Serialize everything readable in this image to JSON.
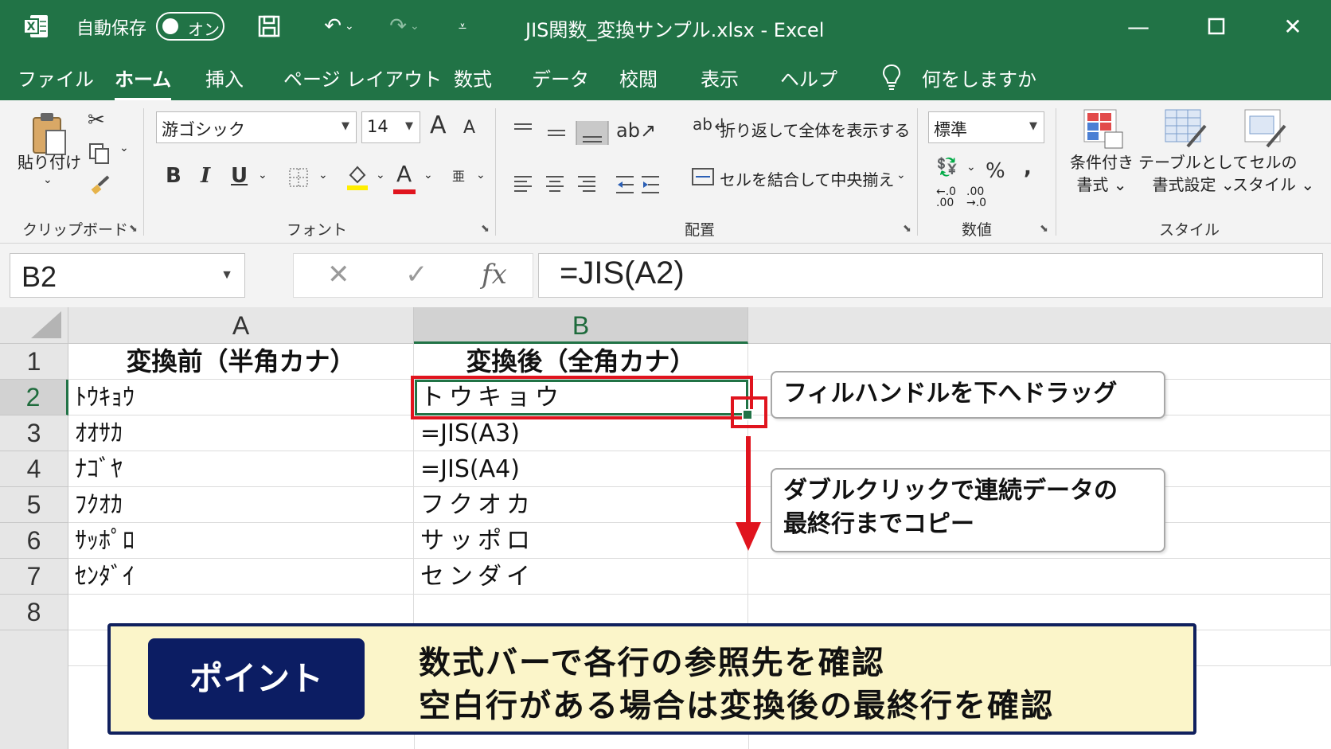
{
  "titlebar": {
    "autosave_label": "自動保存",
    "autosave_state": "オン",
    "doc_title": "JIS関数_変換サンプル.xlsx  -  Excel",
    "icons": [
      "excel-logo-icon",
      "save-icon",
      "undo-icon",
      "redo-icon",
      "customize-qat-icon",
      "minimize-icon",
      "maximize-icon",
      "close-icon"
    ]
  },
  "tabs": [
    "ファイル",
    "ホーム",
    "挿入",
    "ページ レイアウト",
    "数式",
    "データ",
    "校閲",
    "表示",
    "ヘルプ"
  ],
  "active_tab": "ホーム",
  "tell_me": "何をしますか",
  "ribbon": {
    "clipboard": {
      "paste": "貼り付け",
      "label": "クリップボード"
    },
    "font": {
      "name": "游ゴシック",
      "size": "14",
      "label": "フォント",
      "bold": "B",
      "italic": "I",
      "underline": "U",
      "grow": "A",
      "shrink": "A",
      "font_color_letter": "A",
      "phonetic": "亜"
    },
    "alignment": {
      "wrap_text": "折り返して全体を表示する",
      "merge_center": "セルを結合して中央揃え",
      "label": "配置"
    },
    "number": {
      "format": "標準",
      "percent": "%",
      "comma": ",",
      "label": "数値"
    },
    "styles": {
      "conditional": [
        "条件付き",
        "書式"
      ],
      "table": [
        "テーブルとして",
        "書式設定"
      ],
      "cell": [
        "セルの",
        "スタイル"
      ],
      "label": "スタイル"
    }
  },
  "formula_bar": {
    "name_box": "B2",
    "cancel": "✕",
    "enter": "✓",
    "fx": "fx",
    "formula": "=JIS(A2)"
  },
  "sheet": {
    "columns": [
      "A",
      "B"
    ],
    "rows": [
      "1",
      "2",
      "3",
      "4",
      "5",
      "6",
      "7",
      "8"
    ],
    "header_a": "変換前（半角カナ）",
    "header_b": "変換後（全角カナ）",
    "col_a": [
      "ﾄｳｷｮｳ",
      "ｵｵｻｶ",
      "ﾅｺﾞﾔ",
      "ﾌｸｵｶ",
      "ｻｯﾎﾟﾛ",
      "ｾﾝﾀﾞｲ"
    ],
    "col_b": [
      "トウキョウ",
      "=JIS(A3)",
      "=JIS(A4)",
      "フクオカ",
      "サッポロ",
      "センダイ"
    ],
    "active_cell": "B2",
    "accent": "#217346",
    "highlight": "#e0141e"
  },
  "callouts": {
    "drag": "フィルハンドルを下へドラッグ",
    "dblclick_1": "ダブルクリックで連続データの",
    "dblclick_2": "最終行までコピー"
  },
  "point": {
    "badge": "ポイント",
    "line1": "数式バーで各行の参照先を確認",
    "line2": "空白行がある場合は変換後の最終行を確認"
  }
}
